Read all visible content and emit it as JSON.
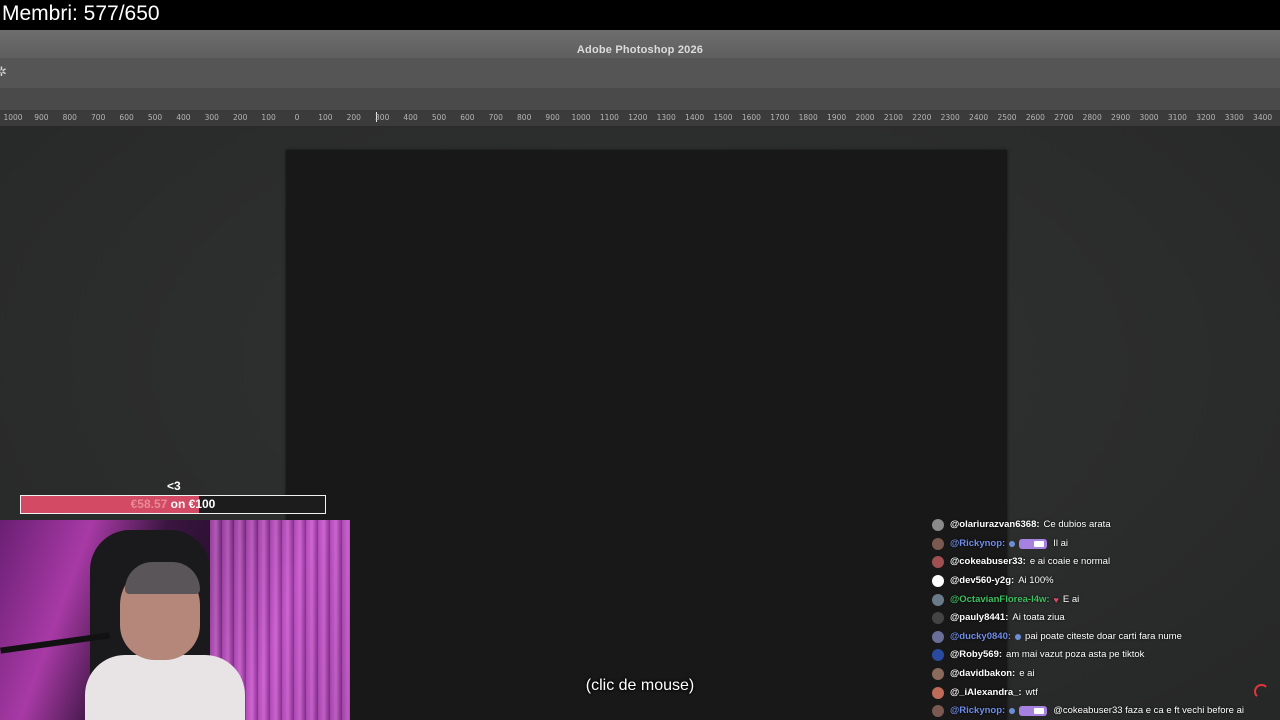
{
  "overlay": {
    "member_count": "Membri: 577/650"
  },
  "photoshop": {
    "title": "Adobe Photoshop 2026",
    "ruler_ticks": [
      "1000",
      "900",
      "800",
      "700",
      "600",
      "500",
      "400",
      "300",
      "200",
      "100",
      "0",
      "100",
      "200",
      "300",
      "400",
      "500",
      "600",
      "700",
      "800",
      "900",
      "1000",
      "1100",
      "1200",
      "1300",
      "1400",
      "1500",
      "1600",
      "1700",
      "1800",
      "1900",
      "2000",
      "2100",
      "2200",
      "2300",
      "2400",
      "2500",
      "2600",
      "2700",
      "2800",
      "2900",
      "3000",
      "3100",
      "3200",
      "3300",
      "3400"
    ]
  },
  "donation_goal": {
    "heart": "<3",
    "current": "€58.57",
    "separator": " on ",
    "target": "€100",
    "progress_fraction": 0.5857
  },
  "subtitle": "(clic de mouse)",
  "chat": {
    "messages": [
      {
        "user": "@olariurazvan6368:",
        "user_color": "#ffffff",
        "text": "Ce dubios arata",
        "avatar_color": "#8a8a8a",
        "badge": "none"
      },
      {
        "user": "@Rickynop:",
        "user_color": "#6f8ce8",
        "text": "Il ai",
        "avatar_color": "#7a5a50",
        "badge": "dot-pill"
      },
      {
        "user": "@cokeabuser33:",
        "user_color": "#ffffff",
        "text": "e ai coaie e normal",
        "avatar_color": "#a05050",
        "badge": "none"
      },
      {
        "user": "@dev560-y2g:",
        "user_color": "#ffffff",
        "text": "Ai 100%",
        "avatar_color": "#ffffff",
        "badge": "none"
      },
      {
        "user": "@OctavianFlorea-l4w:",
        "user_color": "#3fbf5f",
        "text": "E ai",
        "avatar_color": "#6a7a8a",
        "badge": "heart"
      },
      {
        "user": "@pauly8441:",
        "user_color": "#ffffff",
        "text": "Ai toata ziua",
        "avatar_color": "#444444",
        "badge": "none"
      },
      {
        "user": "@ducky0840:",
        "user_color": "#6f8ce8",
        "text": "pai poate citeste doar carti fara nume",
        "avatar_color": "#6a6f9a",
        "badge": "dot"
      },
      {
        "user": "@Roby569:",
        "user_color": "#ffffff",
        "text": "am mai vazut poza asta pe tiktok",
        "avatar_color": "#2a4aa0",
        "badge": "none"
      },
      {
        "user": "@davidbakon:",
        "user_color": "#ffffff",
        "text": "e ai",
        "avatar_color": "#8a6a5a",
        "badge": "none"
      },
      {
        "user": "@_iAlexandra_:",
        "user_color": "#ffffff",
        "text": "wtf",
        "avatar_color": "#c06a5a",
        "badge": "none"
      },
      {
        "user": "@Rickynop:",
        "user_color": "#6f8ce8",
        "text": "@cokeabuser33 faza e ca e ft vechi before ai",
        "avatar_color": "#7a5a50",
        "badge": "dot-pill"
      }
    ]
  },
  "colors": {
    "goal_fill": "#d24a63",
    "workspace": "#2e2f2f",
    "canvas": "#181818"
  }
}
